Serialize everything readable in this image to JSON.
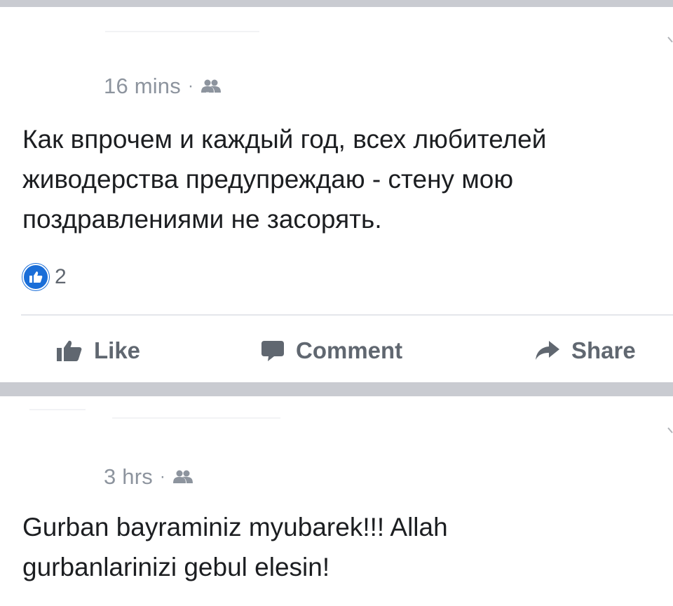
{
  "posts": [
    {
      "timestamp": "16 mins",
      "separator": "·",
      "privacy_icon": "friends-icon",
      "text": "Как впрочем и каждый год, всех любителей живодерства предупреждаю - стену мою поздравлениями не засорять.",
      "reactions": {
        "icon": "like-reaction-icon",
        "count": "2"
      },
      "actions": [
        {
          "icon": "thumbs-up-icon",
          "label": "Like"
        },
        {
          "icon": "comment-icon",
          "label": "Comment"
        },
        {
          "icon": "share-arrow-icon",
          "label": "Share"
        }
      ]
    },
    {
      "timestamp": "3 hrs",
      "separator": "·",
      "privacy_icon": "friends-icon",
      "text": "Gurban bayraminiz myubarek!!!  Allah gurbanlarinizi gebul elesin!"
    }
  ],
  "colors": {
    "divider": "#c9cbd1",
    "meta_text": "#8d949e",
    "body_text": "#1c1e21",
    "action_text": "#606770",
    "like_blue": "#1a6ed8"
  }
}
